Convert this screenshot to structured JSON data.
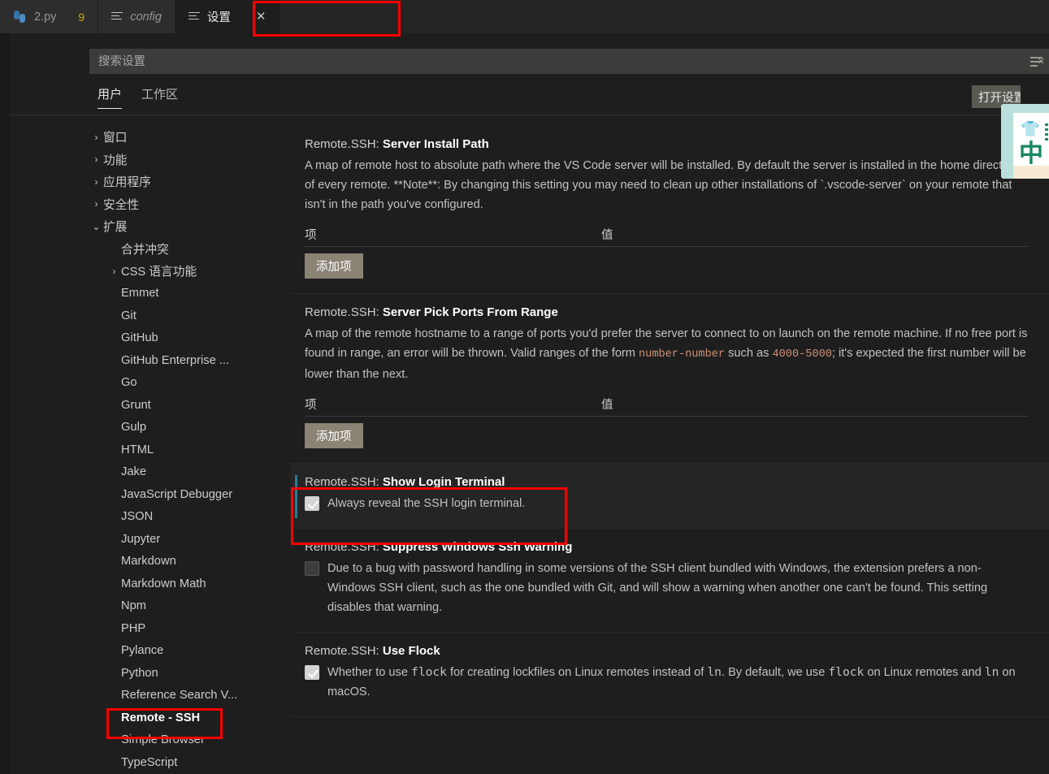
{
  "window": {
    "tabs": [
      {
        "icon": "python-icon",
        "label": "2.py",
        "badge": "9",
        "active": false,
        "italic": false,
        "closable": false
      },
      {
        "icon": "settings-list-icon",
        "label": "config",
        "badge": "",
        "active": false,
        "italic": true,
        "closable": false
      },
      {
        "icon": "settings-list-icon",
        "label": "设置",
        "badge": "",
        "active": true,
        "italic": false,
        "closable": true,
        "close_label": "✕"
      }
    ]
  },
  "search": {
    "placeholder": "搜索设置",
    "value": "",
    "clear_icon": "filter-clear-icon"
  },
  "scope_tabs": [
    {
      "label": "用户",
      "active": true
    },
    {
      "label": "工作区",
      "active": false
    }
  ],
  "tooltip": {
    "text": "打开设置(JSON)"
  },
  "ime_overlay": {
    "shirt_glyph": "👕",
    "mode_glyph": "中"
  },
  "sidebar": {
    "items": [
      {
        "label": "窗口",
        "chev": "›",
        "indent": 0,
        "selected": false
      },
      {
        "label": "功能",
        "chev": "›",
        "indent": 0,
        "selected": false
      },
      {
        "label": "应用程序",
        "chev": "›",
        "indent": 0,
        "selected": false
      },
      {
        "label": "安全性",
        "chev": "›",
        "indent": 0,
        "selected": false
      },
      {
        "label": "扩展",
        "chev": "⌄",
        "indent": 0,
        "selected": false
      },
      {
        "label": "合并冲突",
        "chev": "",
        "indent": 1,
        "selected": false
      },
      {
        "label": "CSS 语言功能",
        "chev": "›",
        "indent": 1,
        "selected": false
      },
      {
        "label": "Emmet",
        "chev": "",
        "indent": 1,
        "selected": false
      },
      {
        "label": "Git",
        "chev": "",
        "indent": 1,
        "selected": false
      },
      {
        "label": "GitHub",
        "chev": "",
        "indent": 1,
        "selected": false
      },
      {
        "label": "GitHub Enterprise ...",
        "chev": "",
        "indent": 1,
        "selected": false
      },
      {
        "label": "Go",
        "chev": "",
        "indent": 1,
        "selected": false
      },
      {
        "label": "Grunt",
        "chev": "",
        "indent": 1,
        "selected": false
      },
      {
        "label": "Gulp",
        "chev": "",
        "indent": 1,
        "selected": false
      },
      {
        "label": "HTML",
        "chev": "",
        "indent": 1,
        "selected": false
      },
      {
        "label": "Jake",
        "chev": "",
        "indent": 1,
        "selected": false
      },
      {
        "label": "JavaScript Debugger",
        "chev": "",
        "indent": 1,
        "selected": false
      },
      {
        "label": "JSON",
        "chev": "",
        "indent": 1,
        "selected": false
      },
      {
        "label": "Jupyter",
        "chev": "",
        "indent": 1,
        "selected": false
      },
      {
        "label": "Markdown",
        "chev": "",
        "indent": 1,
        "selected": false
      },
      {
        "label": "Markdown Math",
        "chev": "",
        "indent": 1,
        "selected": false
      },
      {
        "label": "Npm",
        "chev": "",
        "indent": 1,
        "selected": false
      },
      {
        "label": "PHP",
        "chev": "",
        "indent": 1,
        "selected": false
      },
      {
        "label": "Pylance",
        "chev": "",
        "indent": 1,
        "selected": false
      },
      {
        "label": "Python",
        "chev": "",
        "indent": 1,
        "selected": false
      },
      {
        "label": "Reference Search V...",
        "chev": "",
        "indent": 1,
        "selected": false
      },
      {
        "label": "Remote - SSH",
        "chev": "",
        "indent": 1,
        "selected": true
      },
      {
        "label": "Simple Browser",
        "chev": "",
        "indent": 1,
        "selected": false
      },
      {
        "label": "TypeScript",
        "chev": "",
        "indent": 1,
        "selected": false
      }
    ]
  },
  "settings": [
    {
      "id": "server-install-path",
      "prefix": "Remote.SSH: ",
      "name": "Server Install Path",
      "control": "object-table",
      "desc_parts": [
        {
          "t": "A map of remote host to absolute path where the VS Code server will be installed. By default the server is installed in the home directory of every remote. **Note**: By changing this setting you may need to clean up other installations of `.vscode-server` on your remote that isn't in the path you've configured.",
          "code": false
        }
      ],
      "table": {
        "col_item": "项",
        "col_value": "值",
        "add_label": "添加项",
        "rows": []
      },
      "focused": false
    },
    {
      "id": "server-pick-ports-from-range",
      "prefix": "Remote.SSH: ",
      "name": "Server Pick Ports From Range",
      "control": "object-table",
      "desc_parts": [
        {
          "t": "A map of the remote hostname to a range of ports you'd prefer the server to connect to on launch on the remote machine. If no free port is found in range, an error will be thrown. Valid ranges of the form ",
          "code": false
        },
        {
          "t": "number-number",
          "code": true
        },
        {
          "t": " such as ",
          "code": false
        },
        {
          "t": "4000-5000",
          "code": true
        },
        {
          "t": "; it's expected the first number will be lower than the next.",
          "code": false
        }
      ],
      "table": {
        "col_item": "项",
        "col_value": "值",
        "add_label": "添加项",
        "rows": []
      },
      "focused": false
    },
    {
      "id": "show-login-terminal",
      "prefix": "Remote.SSH: ",
      "name": "Show Login Terminal",
      "control": "checkbox",
      "checked": true,
      "gear_icon": "gear-icon",
      "checkbox_label_parts": [
        {
          "t": "Always reveal the SSH login terminal.",
          "code": false
        }
      ],
      "focused": true
    },
    {
      "id": "suppress-windows-ssh-warning",
      "prefix": "Remote.SSH: ",
      "name": "Suppress Windows Ssh Warning",
      "control": "checkbox",
      "checked": false,
      "checkbox_label_parts": [
        {
          "t": "Due to a bug with password handling in some versions of the SSH client bundled with Windows, the extension prefers a non-Windows SSH client, such as the one bundled with Git, and will show a warning when another one can't be found. This setting disables that warning.",
          "code": false
        }
      ],
      "focused": false
    },
    {
      "id": "use-flock",
      "prefix": "Remote.SSH: ",
      "name": "Use Flock",
      "control": "checkbox",
      "checked": true,
      "checkbox_label_parts": [
        {
          "t": "Whether to use ",
          "code": false
        },
        {
          "t": "flock",
          "code": true
        },
        {
          "t": " for creating lockfiles on Linux remotes instead of ",
          "code": false
        },
        {
          "t": "ln",
          "code": true
        },
        {
          "t": ". By default, we use ",
          "code": false
        },
        {
          "t": "flock",
          "code": true
        },
        {
          "t": " on Linux remotes and ",
          "code": false
        },
        {
          "t": "ln",
          "code": true
        },
        {
          "t": " on macOS.",
          "code": false
        }
      ],
      "focused": false
    }
  ],
  "annotations": [
    {
      "id": "settings-tab-highlight",
      "color": "#fe0000"
    },
    {
      "id": "remote-ssh-item-highlight",
      "color": "#fe0000"
    },
    {
      "id": "show-login-terminal-highlight",
      "color": "#fe0000"
    }
  ],
  "colors": {
    "editor_bg": "#1e1e1e",
    "tabbar_bg": "#252526",
    "tab_inactive_bg": "#2d2d2d",
    "accent_focus": "#2a7d96",
    "annotation_red": "#fe0000",
    "code_orange": "#ce9178",
    "badge_yellow": "#cca700",
    "button_bg": "#8b8475"
  }
}
